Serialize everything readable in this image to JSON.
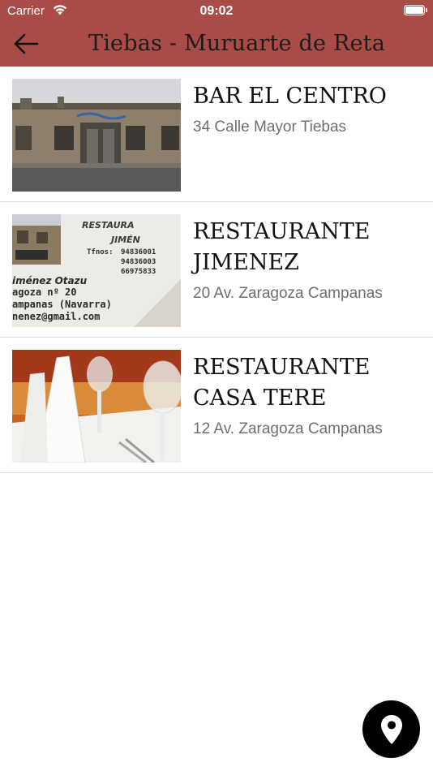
{
  "status_bar": {
    "carrier": "Carrier",
    "time": "09:02"
  },
  "nav": {
    "title": "Tiebas - Muruarte de Reta",
    "back_icon": "arrow-left-icon"
  },
  "restaurants": [
    {
      "name": "BAR EL CENTRO",
      "address": "34 Calle Mayor Tiebas"
    },
    {
      "name": "RESTAURANTE JIMENEZ",
      "address": "20 Av. Zaragoza Campanas"
    },
    {
      "name": "RESTAURANTE CASA TERE",
      "address": "12 Av. Zaragoza Campanas"
    }
  ],
  "card_text": {
    "line1": "RESTAURA",
    "line2": "JIMÉN",
    "phones_label": "Tfnos:",
    "phone1": "94836001",
    "phone2": "94836003",
    "phone3": "66975833",
    "owner": "iménez Otazu",
    "street": "agoza nº 20",
    "town": "ampanas (Navarra)",
    "email": "nenez@gmail.com"
  },
  "fab": {
    "icon": "map-pin-icon"
  },
  "colors": {
    "bar": "#a94c47",
    "fab": "#000000",
    "divider": "#d9d9d9"
  }
}
